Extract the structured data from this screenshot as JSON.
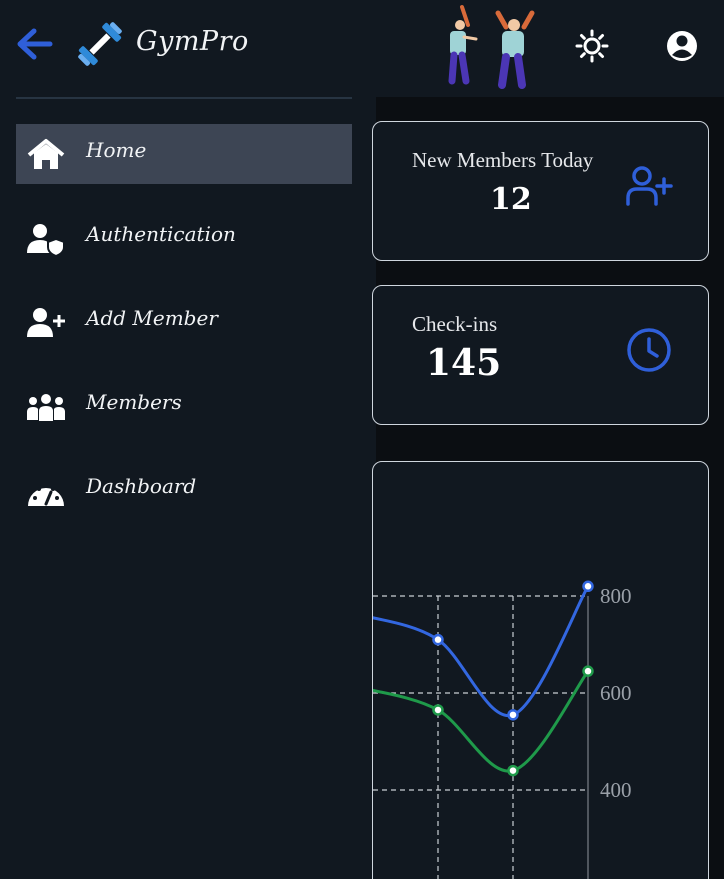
{
  "app": {
    "brand": "GymPro"
  },
  "header": {
    "back_icon": "arrow-left-icon",
    "logo_icon": "dumbbell-icon",
    "illustration": "people-illustration",
    "theme_icon": "sun-icon",
    "account_icon": "account-circle-icon"
  },
  "sidebar": {
    "items": [
      {
        "label": "Home",
        "icon": "home-icon",
        "active": true
      },
      {
        "label": "Authentication",
        "icon": "user-shield-icon",
        "active": false
      },
      {
        "label": "Add Member",
        "icon": "user-plus-icon",
        "active": false
      },
      {
        "label": "Members",
        "icon": "users-icon",
        "active": false
      },
      {
        "label": "Dashboard",
        "icon": "gauge-icon",
        "active": false
      }
    ]
  },
  "stats": [
    {
      "title": "New Members Today",
      "value": "12",
      "icon": "user-plus-icon"
    },
    {
      "title": "Check-ins",
      "value": "145",
      "icon": "clock-icon"
    }
  ],
  "colors": {
    "accent": "#2f5fd9",
    "series_blue": "#3367e0",
    "series_green": "#1f9a4a",
    "sidebar_active": "#3d4554"
  },
  "chart_data": {
    "type": "line",
    "y_ticks": [
      "800",
      "600",
      "400"
    ],
    "ylim": [
      200,
      800
    ],
    "grid": true,
    "series": [
      {
        "values": [
          760,
          710,
          555,
          820
        ]
      },
      {
        "values": [
          610,
          565,
          440,
          645
        ]
      }
    ]
  }
}
